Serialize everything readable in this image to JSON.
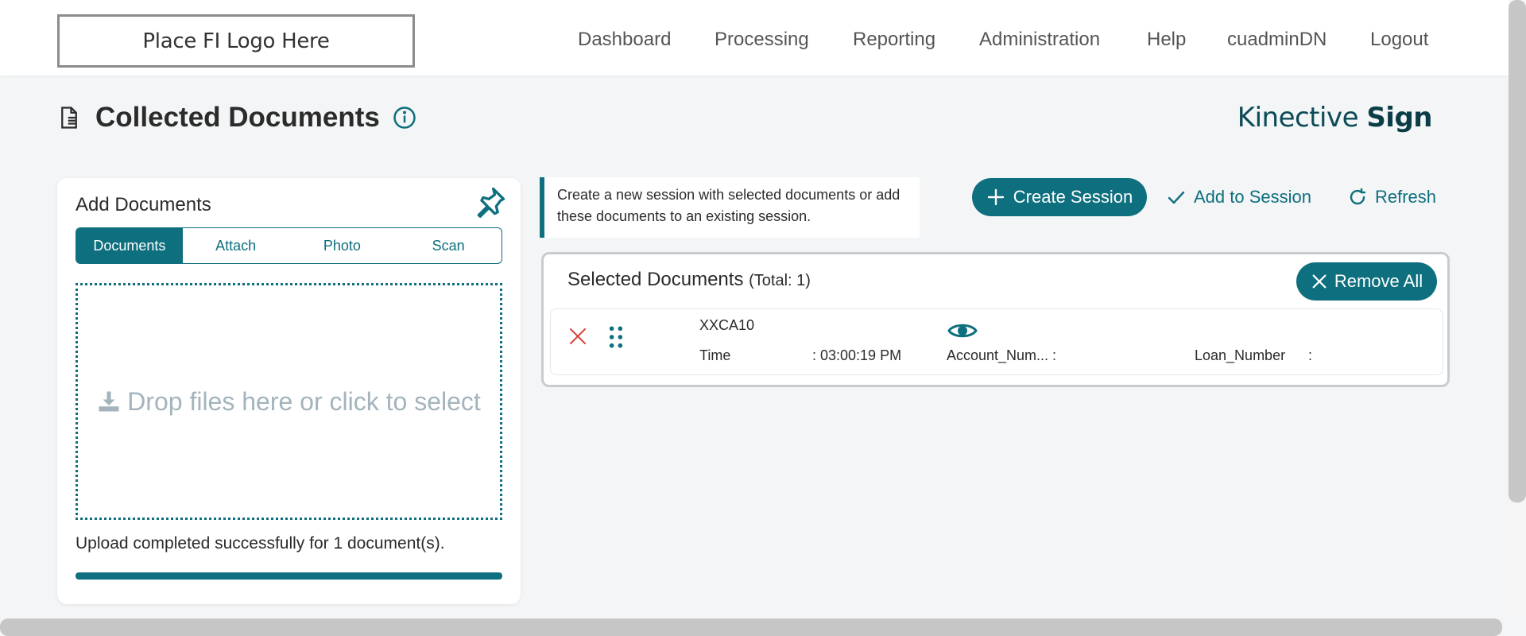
{
  "header": {
    "logo_text": "Place FI Logo Here",
    "nav": [
      "Dashboard",
      "Processing",
      "Reporting",
      "Administration",
      "Help",
      "cuadminDN",
      "Logout"
    ]
  },
  "page": {
    "title": "Collected Documents",
    "brand_light": "Kinective",
    "brand_bold": "Sign"
  },
  "add_documents": {
    "title": "Add Documents",
    "tabs": [
      "Documents",
      "Attach",
      "Photo",
      "Scan"
    ],
    "active_tab": "Documents",
    "dropzone_text": "Drop files here or click to select",
    "upload_message": "Upload completed successfully for 1 document(s).",
    "progress_percent": 100
  },
  "session": {
    "hint": "Create a new session with selected documents or add these documents to an existing session.",
    "create_label": "Create Session",
    "add_label": "Add to Session",
    "refresh_label": "Refresh"
  },
  "selected": {
    "title": "Selected Documents",
    "total_text": "(Total: 1)",
    "remove_all_label": "Remove All",
    "rows": [
      {
        "name": "XXCA10",
        "time_label": "Time",
        "time_value": ": 03:00:19 PM",
        "account_label": "Account_Num... :",
        "loan_label": "Loan_Number",
        "loan_value": ":"
      }
    ]
  },
  "colors": {
    "accent": "#0e6f7e",
    "remove": "#d8443c"
  }
}
